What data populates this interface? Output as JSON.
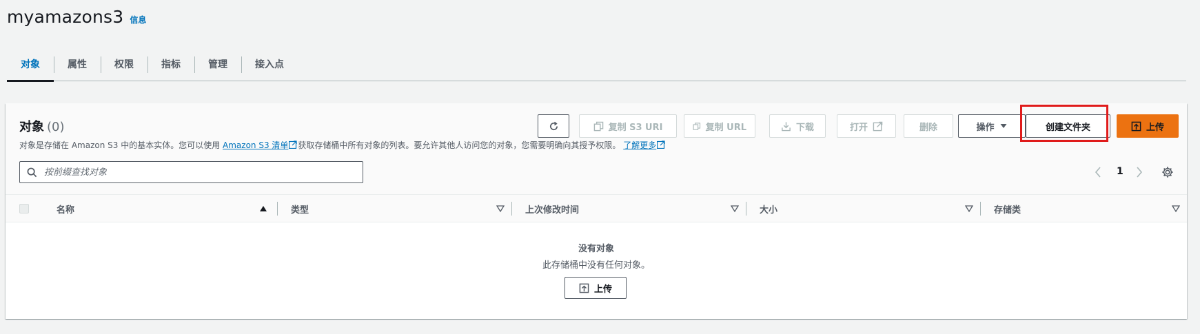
{
  "header": {
    "bucket_name": "myamazons3",
    "info_link": "信息"
  },
  "tabs": [
    {
      "label": "对象",
      "active": true
    },
    {
      "label": "属性",
      "active": false
    },
    {
      "label": "权限",
      "active": false
    },
    {
      "label": "指标",
      "active": false
    },
    {
      "label": "管理",
      "active": false
    },
    {
      "label": "接入点",
      "active": false
    }
  ],
  "objects_panel": {
    "title": "对象",
    "count": "(0)",
    "description_prefix": "对象是存储在 Amazon S3 中的基本实体。您可以使用",
    "inventory_link": "Amazon S3 清单",
    "description_middle": "获取存储桶中所有对象的列表。要允许其他人访问您的对象，您需要明确向其授予权限。",
    "learn_more_link": "了解更多",
    "toolbar": {
      "refresh_icon": "refresh-icon",
      "copy_s3_uri": "复制 S3 URI",
      "copy_url": "复制 URL",
      "download": "下载",
      "open": "打开",
      "delete": "删除",
      "actions": "操作",
      "create_folder": "创建文件夹",
      "upload": "上传"
    },
    "search": {
      "placeholder": "按前缀查找对象",
      "value": ""
    },
    "pagination": {
      "current_page": "1"
    },
    "table": {
      "columns": [
        "名称",
        "类型",
        "上次修改时间",
        "大小",
        "存储类"
      ],
      "sorted_column": "名称",
      "sort_direction": "ascending",
      "rows": []
    },
    "empty_state": {
      "title": "没有对象",
      "description": "此存储桶中没有任何对象。",
      "upload_button": "上传"
    }
  },
  "colors": {
    "accent_link": "#0073bb",
    "primary_button": "#ec7211",
    "highlight_annotation": "#e01b1b"
  }
}
